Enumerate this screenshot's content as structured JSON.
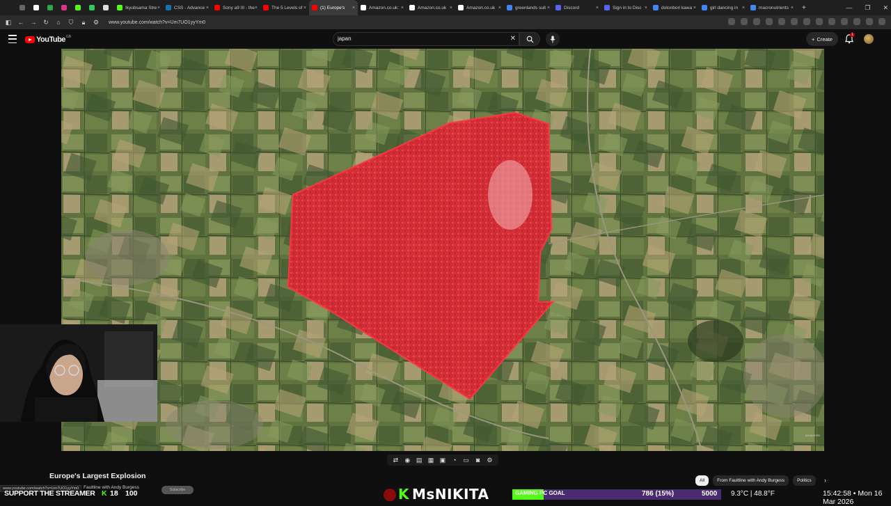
{
  "browser": {
    "tabs": [
      {
        "label": "",
        "icon": "pin-tab-icon",
        "color": "#666666"
      },
      {
        "label": "",
        "icon": "x-icon",
        "color": "#ffffff"
      },
      {
        "label": "",
        "icon": "app-icon",
        "color": "#2aa84a"
      },
      {
        "label": "",
        "icon": "instagram-icon",
        "color": "#d6338b"
      },
      {
        "label": "",
        "icon": "kick-icon",
        "color": "#53fc18"
      },
      {
        "label": "",
        "icon": "green-dot-icon",
        "color": "#34c759"
      },
      {
        "label": "",
        "icon": "doc-icon",
        "color": "#dddddd"
      },
      {
        "label": "Ikyubsama Stre",
        "color": "#53fc18"
      },
      {
        "label": "CSS - Advance",
        "color": "#1572b6"
      },
      {
        "label": "Sony a9 III - the",
        "color": "#ff0000"
      },
      {
        "label": "The 5 Levels of",
        "color": "#ff0000"
      },
      {
        "label": "(1) Europe's",
        "color": "#ff0000",
        "active": true
      },
      {
        "label": "Amazon.co.uk:",
        "color": "#ffffff"
      },
      {
        "label": "Amazon.co.uk",
        "color": "#ffffff"
      },
      {
        "label": "Amazon.co.uk",
        "color": "#ffffff"
      },
      {
        "label": "greenlands suit",
        "color": "#4285f4"
      },
      {
        "label": "Discord",
        "color": "#5865f2"
      },
      {
        "label": "Sign in to Disc",
        "color": "#5865f2"
      },
      {
        "label": "dotonbori kawa",
        "color": "#4285f4"
      },
      {
        "label": "girl dancing in",
        "color": "#4285f4"
      },
      {
        "label": "macronutrients",
        "color": "#4285f4"
      }
    ],
    "url": "www.youtube.com/watch?v=Um7UO1yyYm0"
  },
  "youtube": {
    "logo_text": "YouTube",
    "logo_country": "GB",
    "search_value": "japan",
    "create_label": "Create",
    "notification_count": "1"
  },
  "video": {
    "title": "Europe's Largest Explosion",
    "channel_line": "Faultline with Andy Burgess",
    "status_url": "www.youtube.com/watch?v=Um7UO1yyYm0",
    "subscribe_label": "Subscribe",
    "chips": [
      "All",
      "From Faultline with Andy Burgess",
      "Politics"
    ]
  },
  "stream_overlay": {
    "support_text": "SUPPORT THE STREAMER",
    "support_k": "K",
    "support_count": "18",
    "support_target": "100",
    "kick_letter": "K",
    "streamer_name": "MsNIKITA",
    "goal_label": "GAMING PC GOAL",
    "goal_current": "786 (15%)",
    "goal_percent": 15,
    "goal_target": "5000",
    "weather": "9.3°C | 48.8°F",
    "datetime": "15:42:58 • Mon 16 Mar 2026"
  },
  "colors": {
    "highlight_red": "#e8192c",
    "youtube_red": "#ff0000",
    "kick_green": "#53fc18",
    "goal_purple": "#4a2a70"
  }
}
